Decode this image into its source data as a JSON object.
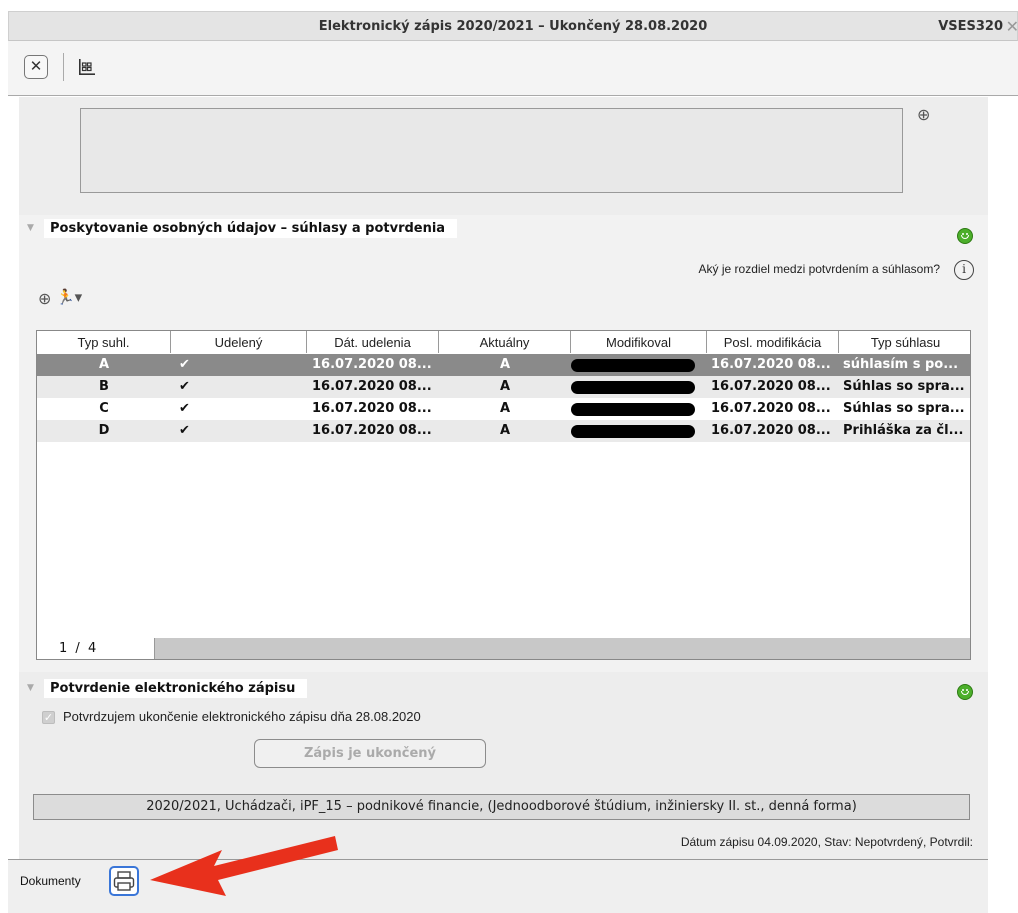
{
  "window": {
    "title": "Elektronický zápis 2020/2021 – Ukončený 28.08.2020",
    "code": "VSES320"
  },
  "toolbar": {
    "close_icon": "close-icon",
    "grid_icon": "grid-icon"
  },
  "consent_section": {
    "title": "Poskytovanie osobných údajov – súhlasy a potvrdenia",
    "status_icon": "smiley-green-icon",
    "help_text": "Aký je rozdiel medzi potvrdením a súhlasom?",
    "columns": [
      "Typ suhl.",
      "Udelený",
      "Dát. udelenia",
      "Aktuálny",
      "Modifikoval",
      "Posl. modifikácia",
      "Typ súhlasu"
    ],
    "rows": [
      {
        "typ": "A",
        "udeleny": "✔",
        "dat": "16.07.2020 08...",
        "aktualny": "A",
        "modifikoval": "",
        "posl": "16.07.2020 08...",
        "typ_suhlasu": "súhlasím s po..."
      },
      {
        "typ": "B",
        "udeleny": "✔",
        "dat": "16.07.2020 08...",
        "aktualny": "A",
        "modifikoval": "",
        "posl": "16.07.2020 08...",
        "typ_suhlasu": "Súhlas so spra..."
      },
      {
        "typ": "C",
        "udeleny": "✔",
        "dat": "16.07.2020 08...",
        "aktualny": "A",
        "modifikoval": "",
        "posl": "16.07.2020 08...",
        "typ_suhlasu": "Súhlas so spra..."
      },
      {
        "typ": "D",
        "udeleny": "✔",
        "dat": "16.07.2020 08...",
        "aktualny": "A",
        "modifikoval": "",
        "posl": "16.07.2020 08...",
        "typ_suhlasu": "Prihláška za čl..."
      }
    ],
    "pager": {
      "current": "1",
      "sep": "/",
      "total": "4"
    }
  },
  "confirm_section": {
    "title": "Potvrdenie elektronického zápisu",
    "checkbox_label": "Potvrdzujem ukončenie elektronického zápisu dňa 28.08.2020",
    "button_label": "Zápis je ukončený",
    "program": "2020/2021, Uchádzači, iPF_15 – podnikové financie, (Jednoodborové štúdium, inžiniersky II. st., denná forma)",
    "datum": "Dátum zápisu 04.09.2020, Stav: Nepotvrdený, Potvrdil:"
  },
  "documents": {
    "label": "Dokumenty",
    "print_icon": "printer-icon"
  },
  "colors": {
    "accent_blue": "#3a76d8",
    "arrow_red": "#e8301c",
    "status_green": "#4caf2b",
    "selected_row": "#8a8a8a"
  }
}
